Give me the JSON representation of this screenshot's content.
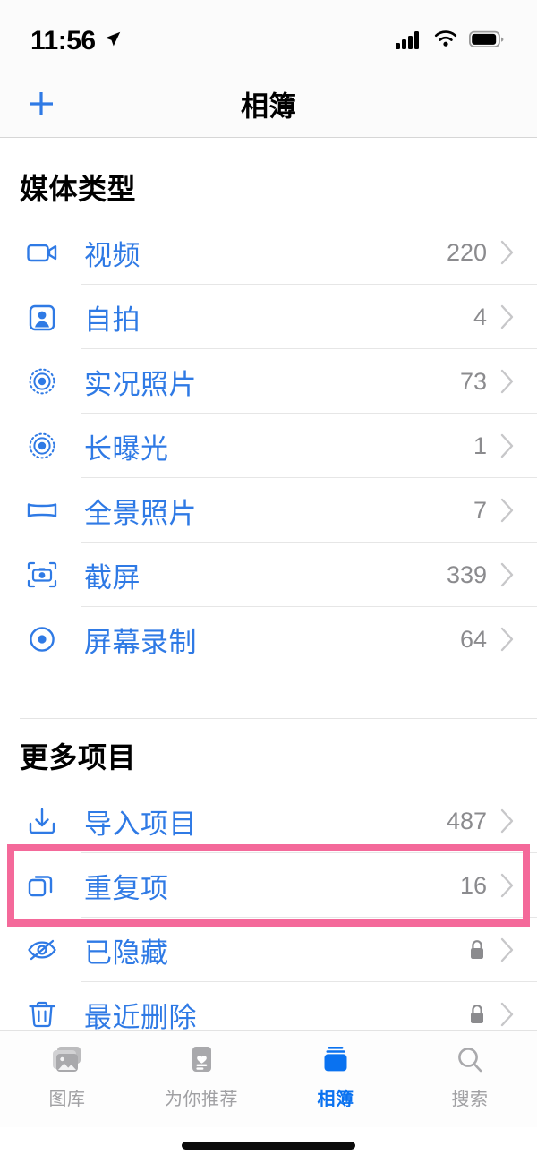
{
  "status_bar": {
    "time": "11:56",
    "location_icon": "location-arrow-icon",
    "cellular_icon": "cellular-signal-icon",
    "wifi_icon": "wifi-icon",
    "battery_icon": "battery-icon"
  },
  "nav_bar": {
    "add_label": "+",
    "title": "相簿"
  },
  "sections": [
    {
      "header": "媒体类型",
      "rows": [
        {
          "icon": "video-camera-icon",
          "label": "视频",
          "count": "220"
        },
        {
          "icon": "selfie-person-icon",
          "label": "自拍",
          "count": "4"
        },
        {
          "icon": "live-photo-icon",
          "label": "实况照片",
          "count": "73"
        },
        {
          "icon": "long-exposure-icon",
          "label": "长曝光",
          "count": "1"
        },
        {
          "icon": "panorama-icon",
          "label": "全景照片",
          "count": "7"
        },
        {
          "icon": "screenshot-icon",
          "label": "截屏",
          "count": "339"
        },
        {
          "icon": "screen-record-icon",
          "label": "屏幕录制",
          "count": "64"
        }
      ]
    },
    {
      "header": "更多项目",
      "rows": [
        {
          "icon": "import-icon",
          "label": "导入项目",
          "count": "487"
        },
        {
          "icon": "duplicates-icon",
          "label": "重复项",
          "count": "16",
          "highlighted": true
        },
        {
          "icon": "eye-slash-icon",
          "label": "已隐藏",
          "locked": true
        },
        {
          "icon": "trash-icon",
          "label": "最近删除",
          "locked": true
        }
      ]
    }
  ],
  "tab_bar": {
    "tabs": [
      {
        "icon": "photos-library-icon",
        "label": "图库",
        "active": false
      },
      {
        "icon": "for-you-icon",
        "label": "为你推荐",
        "active": false
      },
      {
        "icon": "albums-icon",
        "label": "相簿",
        "active": true
      },
      {
        "icon": "search-icon",
        "label": "搜索",
        "active": false
      }
    ]
  },
  "colors": {
    "accent_blue": "#2f7ae5",
    "tab_active_blue": "#0a72f0",
    "highlight_pink": "#f4699a",
    "count_gray": "#8b8b8e"
  }
}
